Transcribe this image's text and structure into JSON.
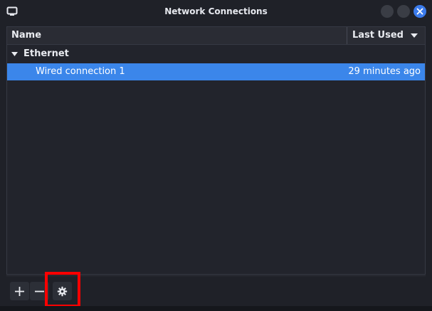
{
  "window": {
    "title": "Network Connections"
  },
  "list": {
    "columns": [
      "Name",
      "Last Used"
    ],
    "groups": [
      {
        "label": "Ethernet",
        "connections": [
          {
            "name": "Wired connection 1",
            "last_used": "29 minutes ago",
            "selected": true
          }
        ]
      }
    ]
  },
  "toolbar": {
    "buttons": [
      "add",
      "remove",
      "settings"
    ]
  },
  "icons": {
    "app": "network-icon",
    "sort": "sort-descending-icon",
    "expander": "expander-open-icon",
    "add": "plus-icon",
    "remove": "minus-icon",
    "settings": "gear-icon",
    "close": "close-icon"
  },
  "colors": {
    "selection": "#3b86ea",
    "close_button": "#3b7bec",
    "highlight": "#ff0000"
  }
}
